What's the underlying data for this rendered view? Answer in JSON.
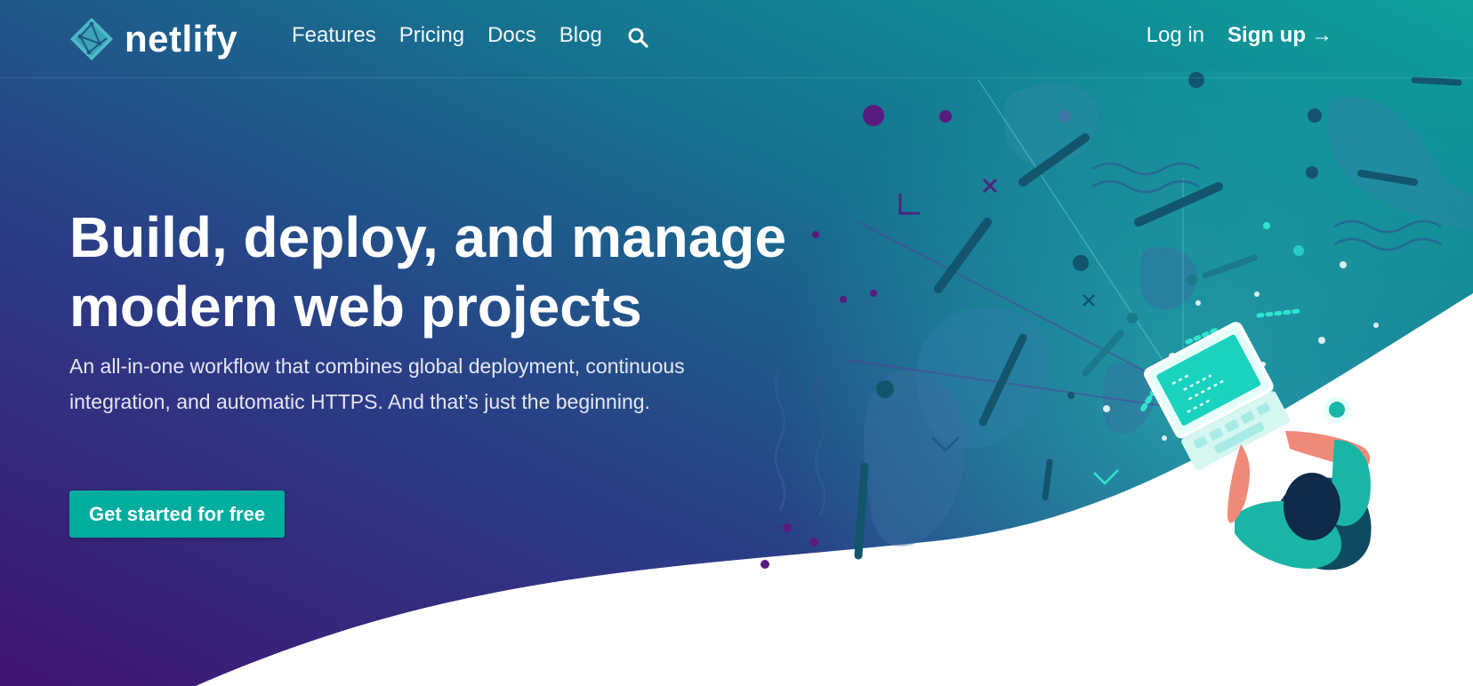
{
  "brand": {
    "name": "netlify",
    "logo_icon": "netlify-logo-icon"
  },
  "nav": {
    "links": [
      {
        "label": "Features"
      },
      {
        "label": "Pricing"
      },
      {
        "label": "Docs"
      },
      {
        "label": "Blog"
      }
    ],
    "search_icon": "search-icon"
  },
  "auth": {
    "login_label": "Log in",
    "signup_label": "Sign up",
    "signup_arrow": "→"
  },
  "hero": {
    "headline": "Build, deploy, and manage modern web projects",
    "subtitle": "An all-in-one workflow that combines global deployment, continuous integration, and automatic HTTPS. And that’s just the beginning.",
    "cta_label": "Get started for free",
    "illustration": "developer-laptop-illustration"
  },
  "colors": {
    "gradient_start": "#3a1677",
    "gradient_mid": "#1f5d8c",
    "gradient_end": "#0f9e9b",
    "accent": "#00ad9f",
    "text": "#ffffff",
    "wave": "#ffffff"
  }
}
